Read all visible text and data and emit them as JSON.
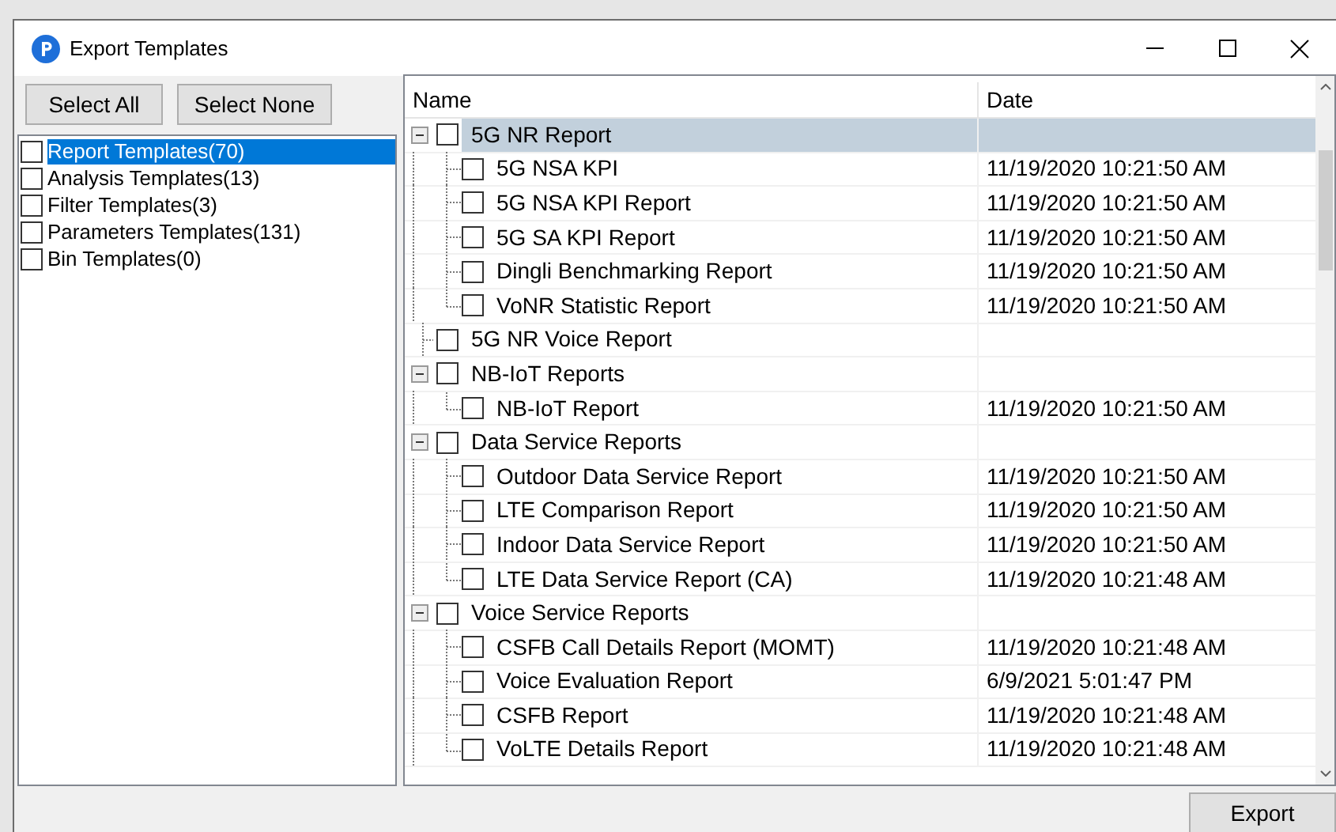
{
  "window": {
    "title": "Export Templates"
  },
  "buttons": [
    "Select All",
    "Select None"
  ],
  "categories": [
    {
      "label": "Report Templates(70)",
      "checked": false,
      "selected": true
    },
    {
      "label": "Analysis Templates(13)",
      "checked": false,
      "selected": false
    },
    {
      "label": "Filter Templates(3)",
      "checked": false,
      "selected": false
    },
    {
      "label": "Parameters Templates(131)",
      "checked": false,
      "selected": false
    },
    {
      "label": "Bin Templates(0)",
      "checked": false,
      "selected": false
    }
  ],
  "table": {
    "columns": [
      "Name",
      "Date"
    ],
    "rows": [
      {
        "name": "5G NR Report",
        "checked": false,
        "expanded": true,
        "selected": true,
        "children": [
          {
            "name": "5G NSA KPI",
            "date": "11/19/2020 10:21:50 AM",
            "checked": false,
            "selected": false
          },
          {
            "name": "5G NSA KPI Report",
            "date": "11/19/2020 10:21:50 AM",
            "checked": false,
            "selected": false
          },
          {
            "name": "5G SA KPI Report",
            "date": "11/19/2020 10:21:50 AM",
            "checked": false,
            "selected": false
          },
          {
            "name": "Dingli Benchmarking Report",
            "date": "11/19/2020 10:21:50 AM",
            "checked": false,
            "selected": false
          },
          {
            "name": "VoNR Statistic Report",
            "date": "11/19/2020 10:21:50 AM",
            "checked": false,
            "selected": false
          }
        ]
      },
      {
        "name": "5G NR Voice Report",
        "checked": false,
        "selected": false
      },
      {
        "name": "NB-IoT Reports",
        "checked": false,
        "expanded": true,
        "selected": false,
        "children": [
          {
            "name": "NB-IoT Report",
            "date": "11/19/2020 10:21:50 AM",
            "checked": false,
            "selected": false
          }
        ]
      },
      {
        "name": "Data Service Reports",
        "checked": false,
        "expanded": true,
        "selected": false,
        "children": [
          {
            "name": "Outdoor Data Service Report",
            "date": "11/19/2020 10:21:50 AM",
            "checked": false,
            "selected": false
          },
          {
            "name": "LTE Comparison Report",
            "date": "11/19/2020 10:21:50 AM",
            "checked": false,
            "selected": false
          },
          {
            "name": "Indoor Data Service Report",
            "date": "11/19/2020 10:21:50 AM",
            "checked": false,
            "selected": false
          },
          {
            "name": "LTE Data Service Report (CA)",
            "date": "11/19/2020 10:21:48 AM",
            "checked": false,
            "selected": false
          }
        ]
      },
      {
        "name": "Voice Service Reports",
        "checked": false,
        "expanded": true,
        "selected": false,
        "children": [
          {
            "name": "CSFB Call Details Report (MOMT)",
            "date": "11/19/2020 10:21:48 AM",
            "checked": false,
            "selected": false
          },
          {
            "name": "Voice Evaluation Report",
            "date": "6/9/2021 5:01:47 PM",
            "checked": false,
            "selected": false
          },
          {
            "name": "CSFB Report",
            "date": "11/19/2020 10:21:48 AM",
            "checked": false,
            "selected": false
          },
          {
            "name": "VoLTE Details Report",
            "date": "11/19/2020 10:21:48 AM",
            "checked": false,
            "selected": false
          }
        ]
      }
    ]
  },
  "export_button": "Export"
}
